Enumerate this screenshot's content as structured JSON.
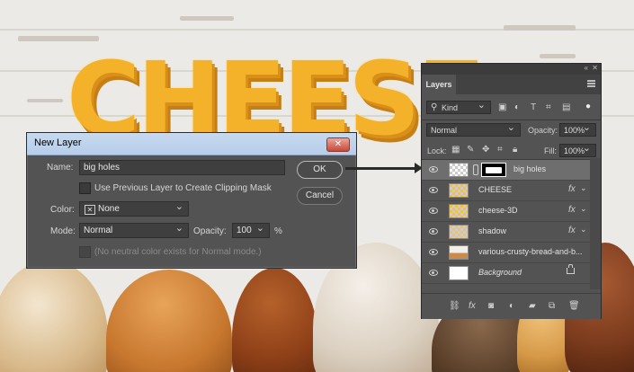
{
  "background": {
    "headline_text": "CHEESE"
  },
  "dialog": {
    "title": "New Layer",
    "name_label": "Name:",
    "name_value": "big holes",
    "use_previous_label": "Use Previous Layer to Create Clipping Mask",
    "color_label": "Color:",
    "color_value": "None",
    "mode_label": "Mode:",
    "mode_value": "Normal",
    "opacity_label": "Opacity:",
    "opacity_value": "100",
    "opacity_unit": "%",
    "neutral_label": "(No neutral color exists for Normal mode.)",
    "ok_label": "OK",
    "cancel_label": "Cancel",
    "close_glyph": "✕"
  },
  "layers_panel": {
    "tab_label": "Layers",
    "filter_value": "Kind",
    "blend_mode": "Normal",
    "opacity_label": "Opacity:",
    "opacity_value": "100%",
    "lock_label": "Lock:",
    "fill_label": "Fill:",
    "fill_value": "100%",
    "layers": [
      {
        "name": "big holes",
        "selected": true,
        "fx": ""
      },
      {
        "name": "CHEESE",
        "selected": false,
        "fx": "fx"
      },
      {
        "name": "cheese-3D",
        "selected": false,
        "fx": "fx"
      },
      {
        "name": "shadow",
        "selected": false,
        "fx": "fx"
      },
      {
        "name": "various-crusty-bread-and-b...",
        "selected": false,
        "fx": ""
      },
      {
        "name": "Background",
        "selected": false,
        "fx": ""
      }
    ]
  },
  "colors": {
    "panel_bg": "#535353",
    "selected_row": "#6e6e6e",
    "dialog_titlebar": "#c6d9f0",
    "cheese_yellow": "#f4b22a"
  }
}
